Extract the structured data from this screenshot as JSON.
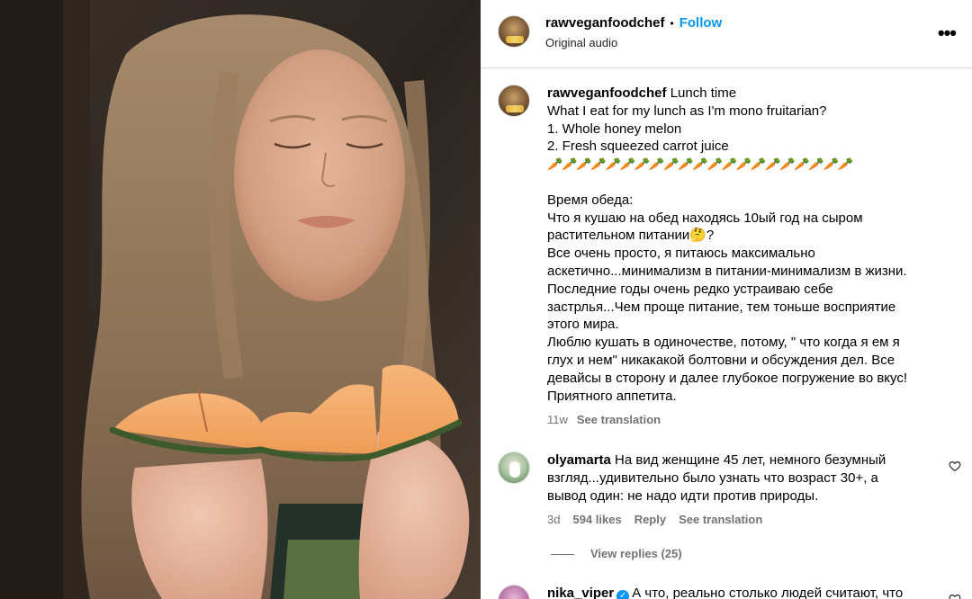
{
  "post": {
    "username": "rawveganfoodchef",
    "follow_label": "Follow",
    "audio_label": "Original audio",
    "more_icon": "more-horizontal-icon"
  },
  "caption": {
    "username": "rawveganfoodchef",
    "first_line": "Lunch time",
    "lines_en": [
      "What I eat for my lunch as I'm mono fruitarian?",
      "1. Whole honey melon",
      "2. Fresh squeezed carrot juice"
    ],
    "carrots": "🥕🥕🥕🥕🥕🥕🥕🥕🥕🥕🥕🥕🥕🥕🥕🥕🥕🥕🥕🥕🥕",
    "lines_ru": [
      "Время обеда:",
      "Что я кушаю на обед находясь 10ый год на сыром",
      "растительном питании🤔?",
      "Все очень просто, я питаюсь максимально",
      "аскетично...минимализм в питании-минимализм в жизни.",
      "Последние годы очень редко устраиваю себе",
      "застрлья...Чем проще питание, тем тоньше восприятие",
      "этого мира.",
      "Люблю кушать в одиночестве, потому, \" что когда я ем я",
      "глух и нем\" никакакой болтовни и обсуждения дел. Все",
      "девайсы в сторону и далее глубокое погружение во вкус!",
      "Приятного аппетита."
    ],
    "time": "11w",
    "see_translation": "See translation"
  },
  "comments": [
    {
      "username": "olyamarta",
      "lines": [
        "На вид женщине 45 лет, немного безумный",
        "взгляд...удивительно было узнать что возраст 30+, а",
        "вывод один: не надо идти против природы."
      ],
      "time": "3d",
      "likes": "594 likes",
      "reply": "Reply",
      "see_translation": "See translation",
      "view_replies": "View replies (25)"
    },
    {
      "username": "nika_viper",
      "text": "А что, реально столько людей считают, что"
    }
  ]
}
